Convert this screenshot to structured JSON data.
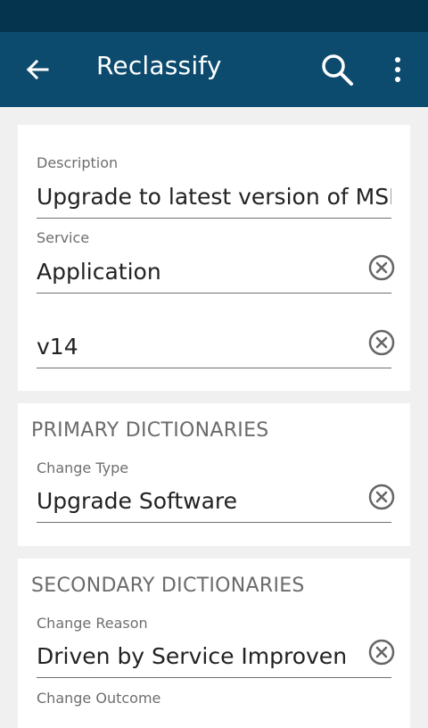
{
  "header": {
    "title": "Reclassify",
    "icons": {
      "back": "arrow-back-icon",
      "search": "search-icon",
      "menu": "more-vert-icon"
    }
  },
  "details": {
    "description_label": "Description",
    "description_value": "Upgrade to latest version of MSM",
    "service_label": "Service",
    "service_value": "Application",
    "version_value": "v14"
  },
  "primary": {
    "title": "PRIMARY DICTIONARIES",
    "change_type_label": "Change Type",
    "change_type_value": "Upgrade Software"
  },
  "secondary": {
    "title": "SECONDARY DICTIONARIES",
    "change_reason_label": "Change Reason",
    "change_reason_value": "Driven by Service Improven",
    "change_outcome_label": "Change Outcome"
  },
  "colors": {
    "status_bar": "#04344e",
    "app_bar": "#0d4b6e",
    "background": "#f0f0f0",
    "card": "#ffffff"
  }
}
